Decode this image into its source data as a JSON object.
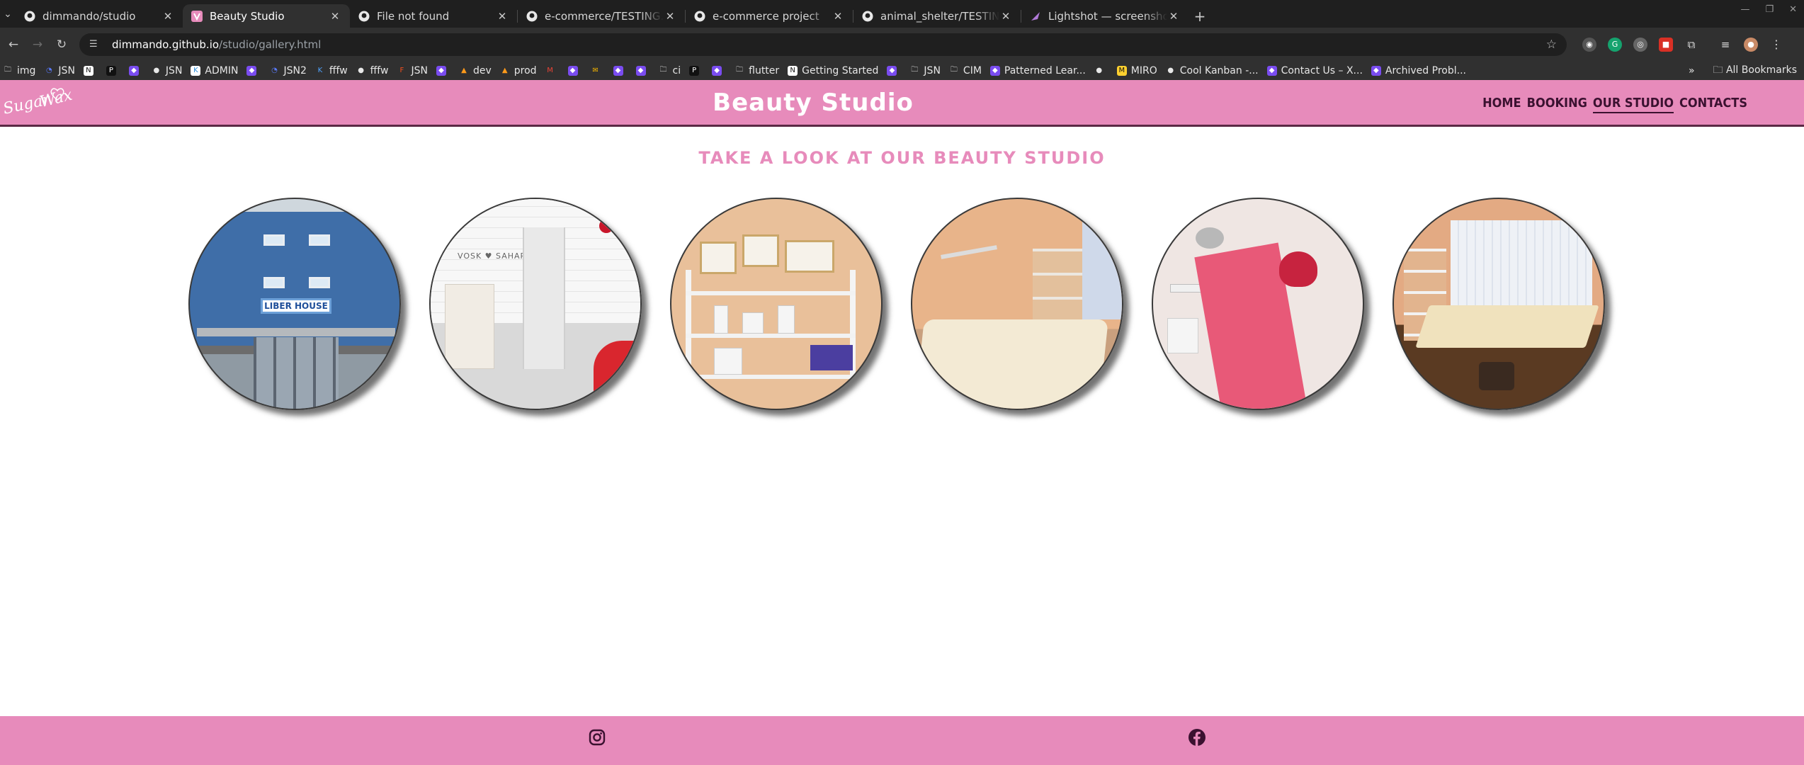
{
  "browser": {
    "tabs": [
      {
        "title": "dimmando/studio",
        "icon": "github-icon",
        "active": false
      },
      {
        "title": "Beauty Studio",
        "icon": "studio-favicon",
        "active": true
      },
      {
        "title": "File not found",
        "icon": "github-icon",
        "active": false
      },
      {
        "title": "e-commerce/TESTING.m",
        "icon": "github-icon",
        "active": false
      },
      {
        "title": "e-commerce project",
        "icon": "github-icon",
        "active": false
      },
      {
        "title": "animal_shelter/TESTING",
        "icon": "github-icon",
        "active": false
      },
      {
        "title": "Lightshot — screenshot",
        "icon": "lightshot-icon",
        "active": false
      }
    ],
    "url_host": "dimmando.github.io",
    "url_path": "/studio/gallery.html",
    "bookmarks": [
      {
        "label": "img",
        "icon": "folder-icon"
      },
      {
        "label": "JSN",
        "icon": "jsn-icon"
      },
      {
        "label": "",
        "icon": "notion-icon"
      },
      {
        "label": "",
        "icon": "p-icon"
      },
      {
        "label": "",
        "icon": "app-icon"
      },
      {
        "label": "JSN",
        "icon": "github-icon"
      },
      {
        "label": "ADMIN",
        "icon": "admin-icon"
      },
      {
        "label": "",
        "icon": "app-icon"
      },
      {
        "label": "JSN2",
        "icon": "jsn-icon"
      },
      {
        "label": "fffw",
        "icon": "k-icon"
      },
      {
        "label": "fffw",
        "icon": "github-icon"
      },
      {
        "label": "JSN",
        "icon": "figma-icon"
      },
      {
        "label": "",
        "icon": "app-icon"
      },
      {
        "label": "dev",
        "icon": "fire-icon"
      },
      {
        "label": "prod",
        "icon": "fire-icon"
      },
      {
        "label": "",
        "icon": "gmail-icon"
      },
      {
        "label": "",
        "icon": "app-icon"
      },
      {
        "label": "",
        "icon": "mail-icon"
      },
      {
        "label": "",
        "icon": "app-icon"
      },
      {
        "label": "",
        "icon": "app-icon"
      },
      {
        "label": "ci",
        "icon": "folder-icon"
      },
      {
        "label": "",
        "icon": "p-icon"
      },
      {
        "label": "",
        "icon": "app-icon"
      },
      {
        "label": "flutter",
        "icon": "folder-icon"
      },
      {
        "label": "Getting Started",
        "icon": "notion-icon"
      },
      {
        "label": "",
        "icon": "app-icon"
      },
      {
        "label": "JSN",
        "icon": "folder-icon"
      },
      {
        "label": "CIM",
        "icon": "folder-icon"
      },
      {
        "label": "Patterned Lear...",
        "icon": "app-icon"
      },
      {
        "label": "",
        "icon": "github-icon"
      },
      {
        "label": "MIRO",
        "icon": "miro-icon"
      },
      {
        "label": "Cool Kanban -...",
        "icon": "github-icon"
      },
      {
        "label": "Contact Us – X...",
        "icon": "app-icon"
      },
      {
        "label": "Archived Probl...",
        "icon": "app-icon"
      }
    ],
    "all_bookmarks": "All Bookmarks"
  },
  "site": {
    "logo_line1": "Sugar",
    "logo_line2": "Wax",
    "title": "Beauty Studio",
    "nav": [
      {
        "label": "HOME",
        "active": false
      },
      {
        "label": "BOOKING",
        "active": false
      },
      {
        "label": "OUR STUDIO",
        "active": true
      },
      {
        "label": "CONTACTS",
        "active": false
      }
    ],
    "heading": "TAKE A LOOK AT OUR BEAUTY STUDIO",
    "photo_texts": {
      "building_sign": "LIBER HOUSE",
      "reception_sign": "VOSK ♥ SAHAR"
    },
    "footer_icons": [
      "instagram-icon",
      "facebook-icon"
    ],
    "colors": {
      "brand_pink": "#e78bbb",
      "dark_plum": "#3b1130"
    }
  }
}
